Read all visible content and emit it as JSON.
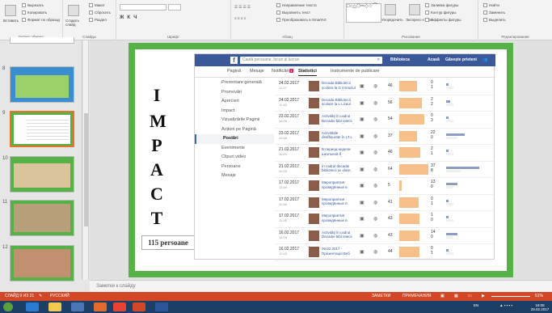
{
  "ribbon": {
    "groups": [
      "Буфер обмена",
      "Слайды",
      "Шрифт",
      "Абзац",
      "Рисование",
      "Редактирование"
    ],
    "paste": "Вставить",
    "create_slide": "Создать слайд",
    "cut": "Вырезать",
    "copy": "Копировать",
    "format_painter": "Формат по образцу",
    "layout": "Макет",
    "reset": "Сбросить",
    "section": "Раздел",
    "text_direction": "Направление текста",
    "align_text": "Выровнять текст",
    "smartart": "Преобразовать в SmartArt",
    "arrange": "Упорядочить",
    "quick_styles": "Экспресс-стили",
    "fill": "Заливка фигуры",
    "outline": "Контур фигуры",
    "effects": "Эффекты фигуры",
    "find": "Найти",
    "replace": "Заменить",
    "select": "Выделить"
  },
  "thumbnails": {
    "numbers": [
      "8",
      "9",
      "10",
      "11",
      "12"
    ]
  },
  "slide": {
    "letters": [
      "I",
      "M",
      "P",
      "A",
      "C",
      "T"
    ],
    "persons": "115 persoane"
  },
  "fb": {
    "logo": "f",
    "search_placeholder": "Caută persoane, locuri și lucruri",
    "nav": {
      "page": "Biblioteca",
      "home": "Acasă",
      "friends": "Găsește prieteni"
    },
    "tabs": {
      "t1": "Pagină",
      "t2": "Mesaje",
      "t3": "Notificări",
      "t3_badge": "1",
      "t4": "Statistici",
      "t5": "Instrumente de publicare"
    },
    "side": [
      "Prezentare generală",
      "Promovări",
      "Aprecieri",
      "Impact",
      "Vizualizările Paginii",
      "Acțiuni pe Pagină",
      "Postări",
      "Evenimente",
      "Clipuri video",
      "Persoane",
      "Mesaje"
    ],
    "rows": [
      {
        "date": "24.02.2017",
        "time": "12:07",
        "title": "Decada Bibliotecii școlare la G imnaziul Nr.3, mun.Bălți",
        "reach": "46",
        "n1": "0",
        "n2": "1",
        "fill": 0.2,
        "b2": 0.03,
        "b3": 0.1
      },
      {
        "date": "24.02.2017",
        "time": "11:46",
        "title": "Decada Bibliotecii școlare la L Liceul Teoretic B.P.Hasdeu",
        "reach": "56",
        "n1": "2",
        "n2": "2",
        "fill": 0.25,
        "b2": 0.05,
        "b3": 0.1
      },
      {
        "date": "23.02.2017",
        "time": "16:56",
        "title": "Activități în cadrul Decadei bibl iotecii școlare, desfășurată în",
        "reach": "54",
        "n1": "0",
        "n2": "3",
        "fill": 0.28,
        "b2": 0.03,
        "b3": 0.1
      },
      {
        "date": "23.02.2017",
        "time": "13:48",
        "title": "Activitățile desfășurate în LT.L ucian Blaga în cadrul decadei",
        "reach": "37",
        "n1": "22",
        "n2": "0",
        "fill": 0.2,
        "b2": 0.25,
        "b3": 0.15
      },
      {
        "date": "21.02.2017",
        "time": "16:20",
        "title": "В период недели школьной б иблиотеки были проведены с",
        "reach": "46",
        "n1": "2",
        "n2": "1",
        "fill": 0.24,
        "b2": 0.03,
        "b3": 0.1
      },
      {
        "date": "21.02.2017",
        "time": "11:28",
        "title": "În cadrul decadei bibliotecii șc olare, desfășurată în perioada",
        "reach": "64",
        "n1": "37",
        "n2": "8",
        "fill": 0.33,
        "b2": 0.45,
        "b3": 0.2
      },
      {
        "date": "17.02.2017",
        "time": "15:49",
        "title": "Мероприятия проведённые в рамках декады школьной би",
        "reach": "5",
        "n1": "13",
        "n2": "0",
        "fill": 0.03,
        "b2": 0.15,
        "b3": 0.1
      },
      {
        "date": "17.02.2017",
        "time": "11:38",
        "title": "Мероприятия проведённые в рамках декады школьной би",
        "reach": "41",
        "n1": "0",
        "n2": "1",
        "fill": 0.22,
        "b2": 0.03,
        "b3": 0.1
      },
      {
        "date": "17.02.2017",
        "time": "11:08",
        "title": "Мероприятия проведённые в рамках декады школьной би",
        "reach": "43",
        "n1": "1",
        "n2": "0",
        "fill": 0.23,
        "b2": 0.03,
        "b3": 0.1
      },
      {
        "date": "16.02.2017",
        "time": "16:09",
        "title": "Activități în cadrul Decadei bibl iotecii școlare la Liceul Teoretic",
        "reach": "43",
        "n1": "14",
        "n2": "0",
        "fill": 0.23,
        "b2": 0.16,
        "b3": 0.1
      },
      {
        "date": "16.02.2017",
        "time": "12:43",
        "title": "06.02.2017 - Презентація Веб гентина 06.02.2017 - Grădina",
        "reach": "44",
        "n1": "0",
        "n2": "1",
        "fill": 0.23,
        "b2": 0.03,
        "b3": 0.1
      }
    ]
  },
  "notes": "Заметки к слайду",
  "status": {
    "slide": "СЛАЙД 9 ИЗ 21",
    "lang": "РУССКИЙ",
    "notes": "ЗАМЕТКИ",
    "comments": "ПРИМЕЧАНИЯ",
    "zoom": "61%"
  },
  "taskbar": {
    "lang": "EN",
    "time": "16:08",
    "date": "28.02.2017"
  },
  "colors": {
    "slide_frame": "#56b146",
    "fb_blue": "#3b5998",
    "status_bar": "#d24726",
    "taskbar": "#1d3f66"
  }
}
